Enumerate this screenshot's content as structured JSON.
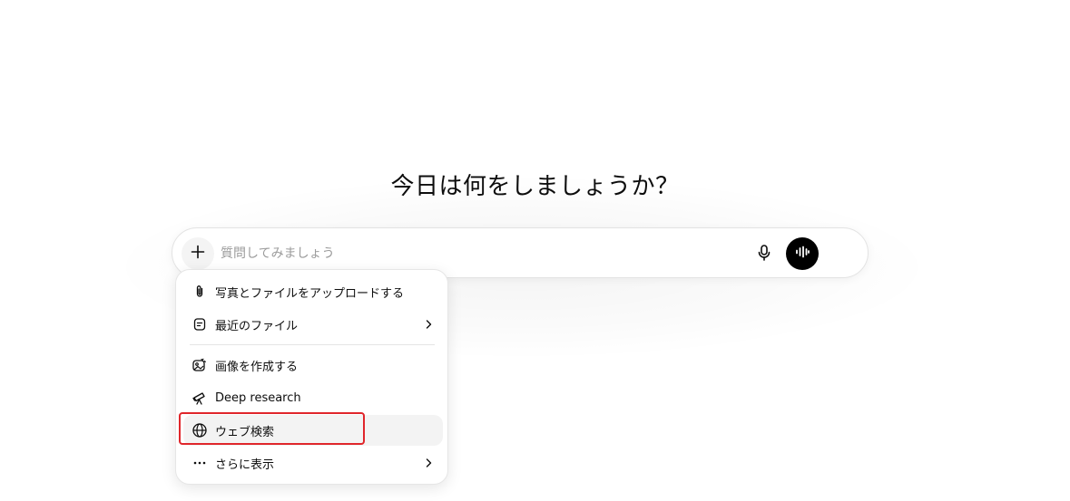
{
  "main": {
    "heading": "今日は何をしましょうか？"
  },
  "composer": {
    "placeholder": "質問してみましょう",
    "value": "",
    "plus_icon": "plus-icon",
    "mic_icon": "microphone-icon",
    "voice_icon": "voice-mode-icon",
    "voice_button_color": "#000000"
  },
  "menu": {
    "items": [
      {
        "label": "写真とファイルをアップロードする",
        "icon": "paperclip-icon",
        "has_submenu": false
      },
      {
        "label": "最近のファイル",
        "icon": "file-icon",
        "has_submenu": true
      },
      {
        "label": "画像を作成する",
        "icon": "image-create-icon",
        "has_submenu": false
      },
      {
        "label": "Deep research",
        "icon": "telescope-icon",
        "has_submenu": false
      },
      {
        "label": "ウェブ検索",
        "icon": "globe-icon",
        "has_submenu": false,
        "highlighted": true
      },
      {
        "label": "さらに表示",
        "icon": "more-dots-icon",
        "has_submenu": true
      }
    ]
  },
  "annotation": {
    "highlight_color": "#e0262b",
    "target": "ウェブ検索"
  }
}
